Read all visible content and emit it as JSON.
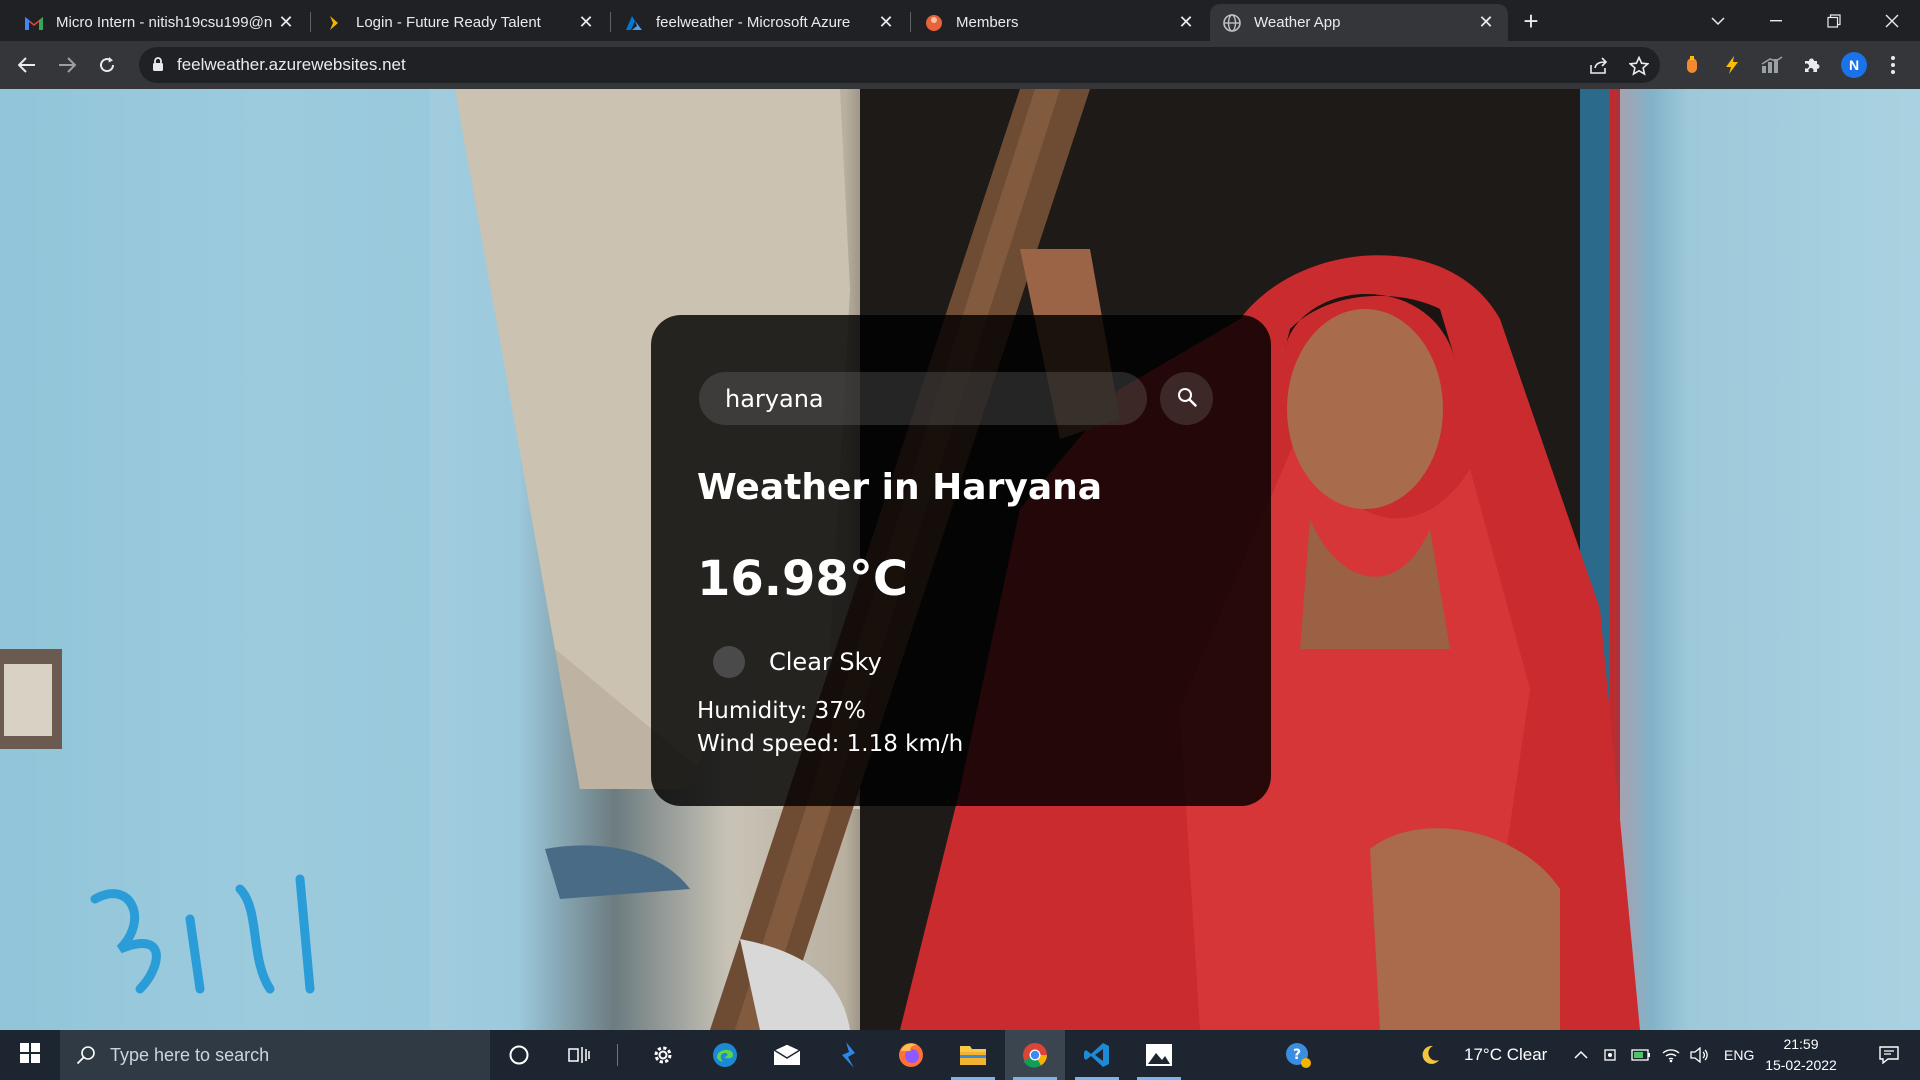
{
  "browser": {
    "tabs": [
      {
        "title": "Micro Intern - nitish19csu199@n",
        "icon": "gmail-icon",
        "active": false
      },
      {
        "title": "Login - Future Ready Talent",
        "icon": "future-ready-talent-icon",
        "active": false
      },
      {
        "title": "feelweather - Microsoft Azure",
        "icon": "azure-icon",
        "active": false
      },
      {
        "title": "Members",
        "icon": "members-icon",
        "active": false
      },
      {
        "title": "Weather App",
        "icon": "globe-icon",
        "active": true
      }
    ],
    "url": "feelweather.azurewebsites.net",
    "profile_initial": "N"
  },
  "weather": {
    "search_value": "haryana",
    "city_heading": "Weather in Haryana",
    "temperature": "16.98°C",
    "condition": "Clear Sky",
    "humidity": "Humidity: 37%",
    "wind": "Wind speed: 1.18 km/h"
  },
  "taskbar": {
    "search_placeholder": "Type here to search",
    "weather_widget": "17°C  Clear",
    "language": "ENG",
    "time": "21:59",
    "date": "15-02-2022"
  },
  "colors": {
    "chrome_dark": "#202124",
    "chrome_toolbar": "#35363a",
    "card_bg": "#000000",
    "taskbar_bg": "#1c2530",
    "accent_blue": "#1a73e8"
  }
}
